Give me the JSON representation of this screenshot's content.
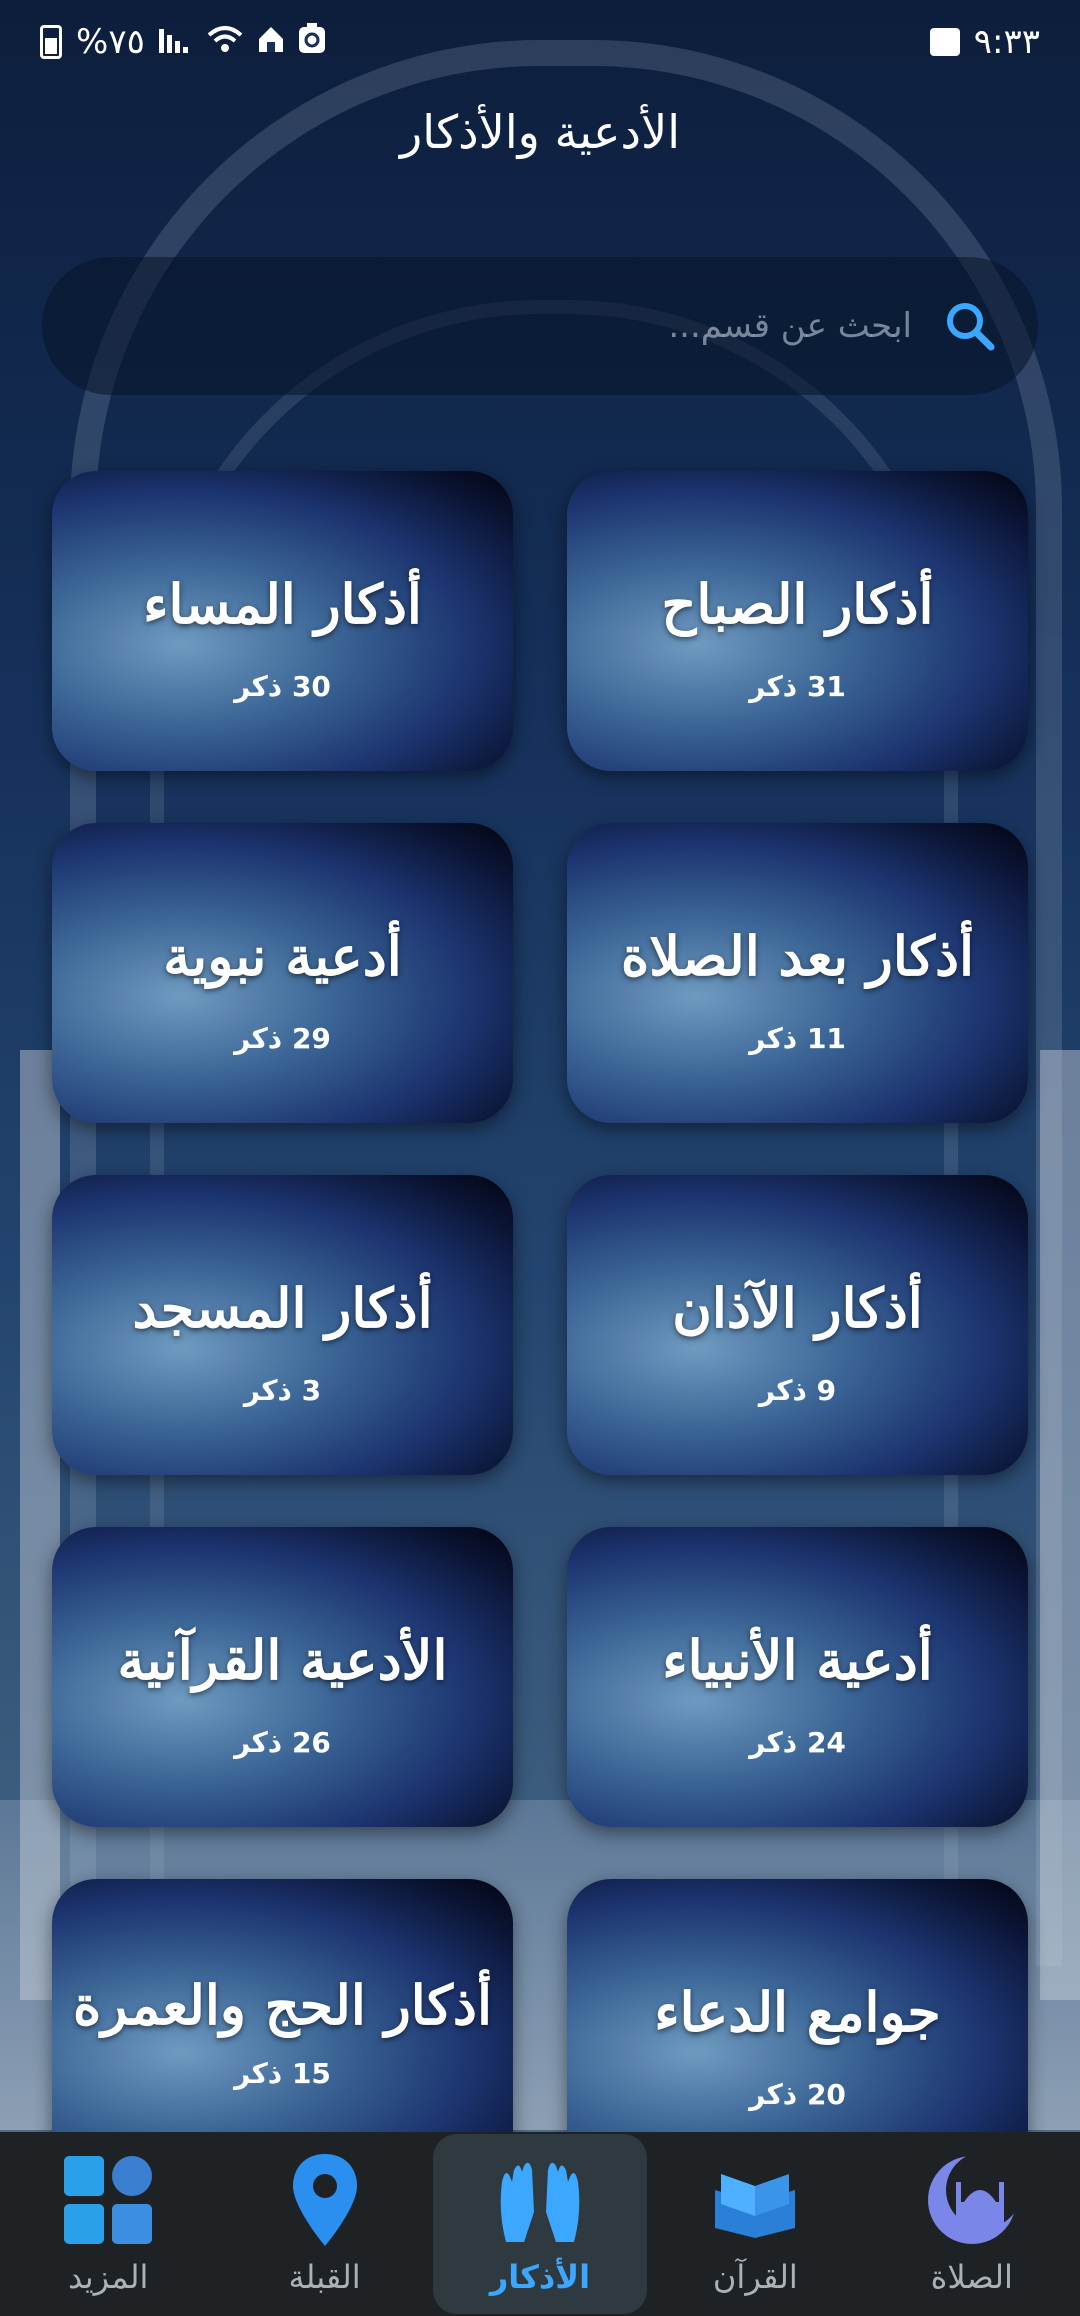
{
  "status_bar": {
    "time": "٩:٣٣",
    "battery_text": "%٧٥",
    "icons": [
      "gallery-icon",
      "battery-icon",
      "signal-icon",
      "wifi-icon",
      "home-icon",
      "recycle-icon"
    ]
  },
  "header": {
    "title": "الأدعية والأذكار"
  },
  "search": {
    "placeholder": "ابحث عن قسم..."
  },
  "categories": [
    {
      "title": "أذكار الصباح",
      "count": "31 ذكر"
    },
    {
      "title": "أذكار المساء",
      "count": "30 ذكر"
    },
    {
      "title": "أذكار بعد الصلاة",
      "count": "11 ذكر"
    },
    {
      "title": "أدعية نبوية",
      "count": "29 ذكر"
    },
    {
      "title": "أذكار الآذان",
      "count": "9 ذكر"
    },
    {
      "title": "أذكار المسجد",
      "count": "3 ذكر"
    },
    {
      "title": "أدعية الأنبياء",
      "count": "24 ذكر"
    },
    {
      "title": "الأدعية القرآنية",
      "count": "26 ذكر"
    },
    {
      "title": "جوامع الدعاء",
      "count": "20 ذكر"
    },
    {
      "title": "أذكار الحج والعمرة",
      "count": "15 ذكر"
    }
  ],
  "bottom_nav": {
    "items": [
      {
        "label": "الصلاة",
        "icon": "mosque-icon"
      },
      {
        "label": "القرآن",
        "icon": "quran-icon"
      },
      {
        "label": "الأذكار",
        "icon": "praying-hands-icon",
        "active": true
      },
      {
        "label": "القبلة",
        "icon": "location-pin-icon"
      },
      {
        "label": "المزيد",
        "icon": "grid-icon"
      }
    ]
  },
  "colors": {
    "accent": "#3ba7ff",
    "nav_bg": "#1f2225",
    "nav_active_bg": "#2f3a40"
  }
}
